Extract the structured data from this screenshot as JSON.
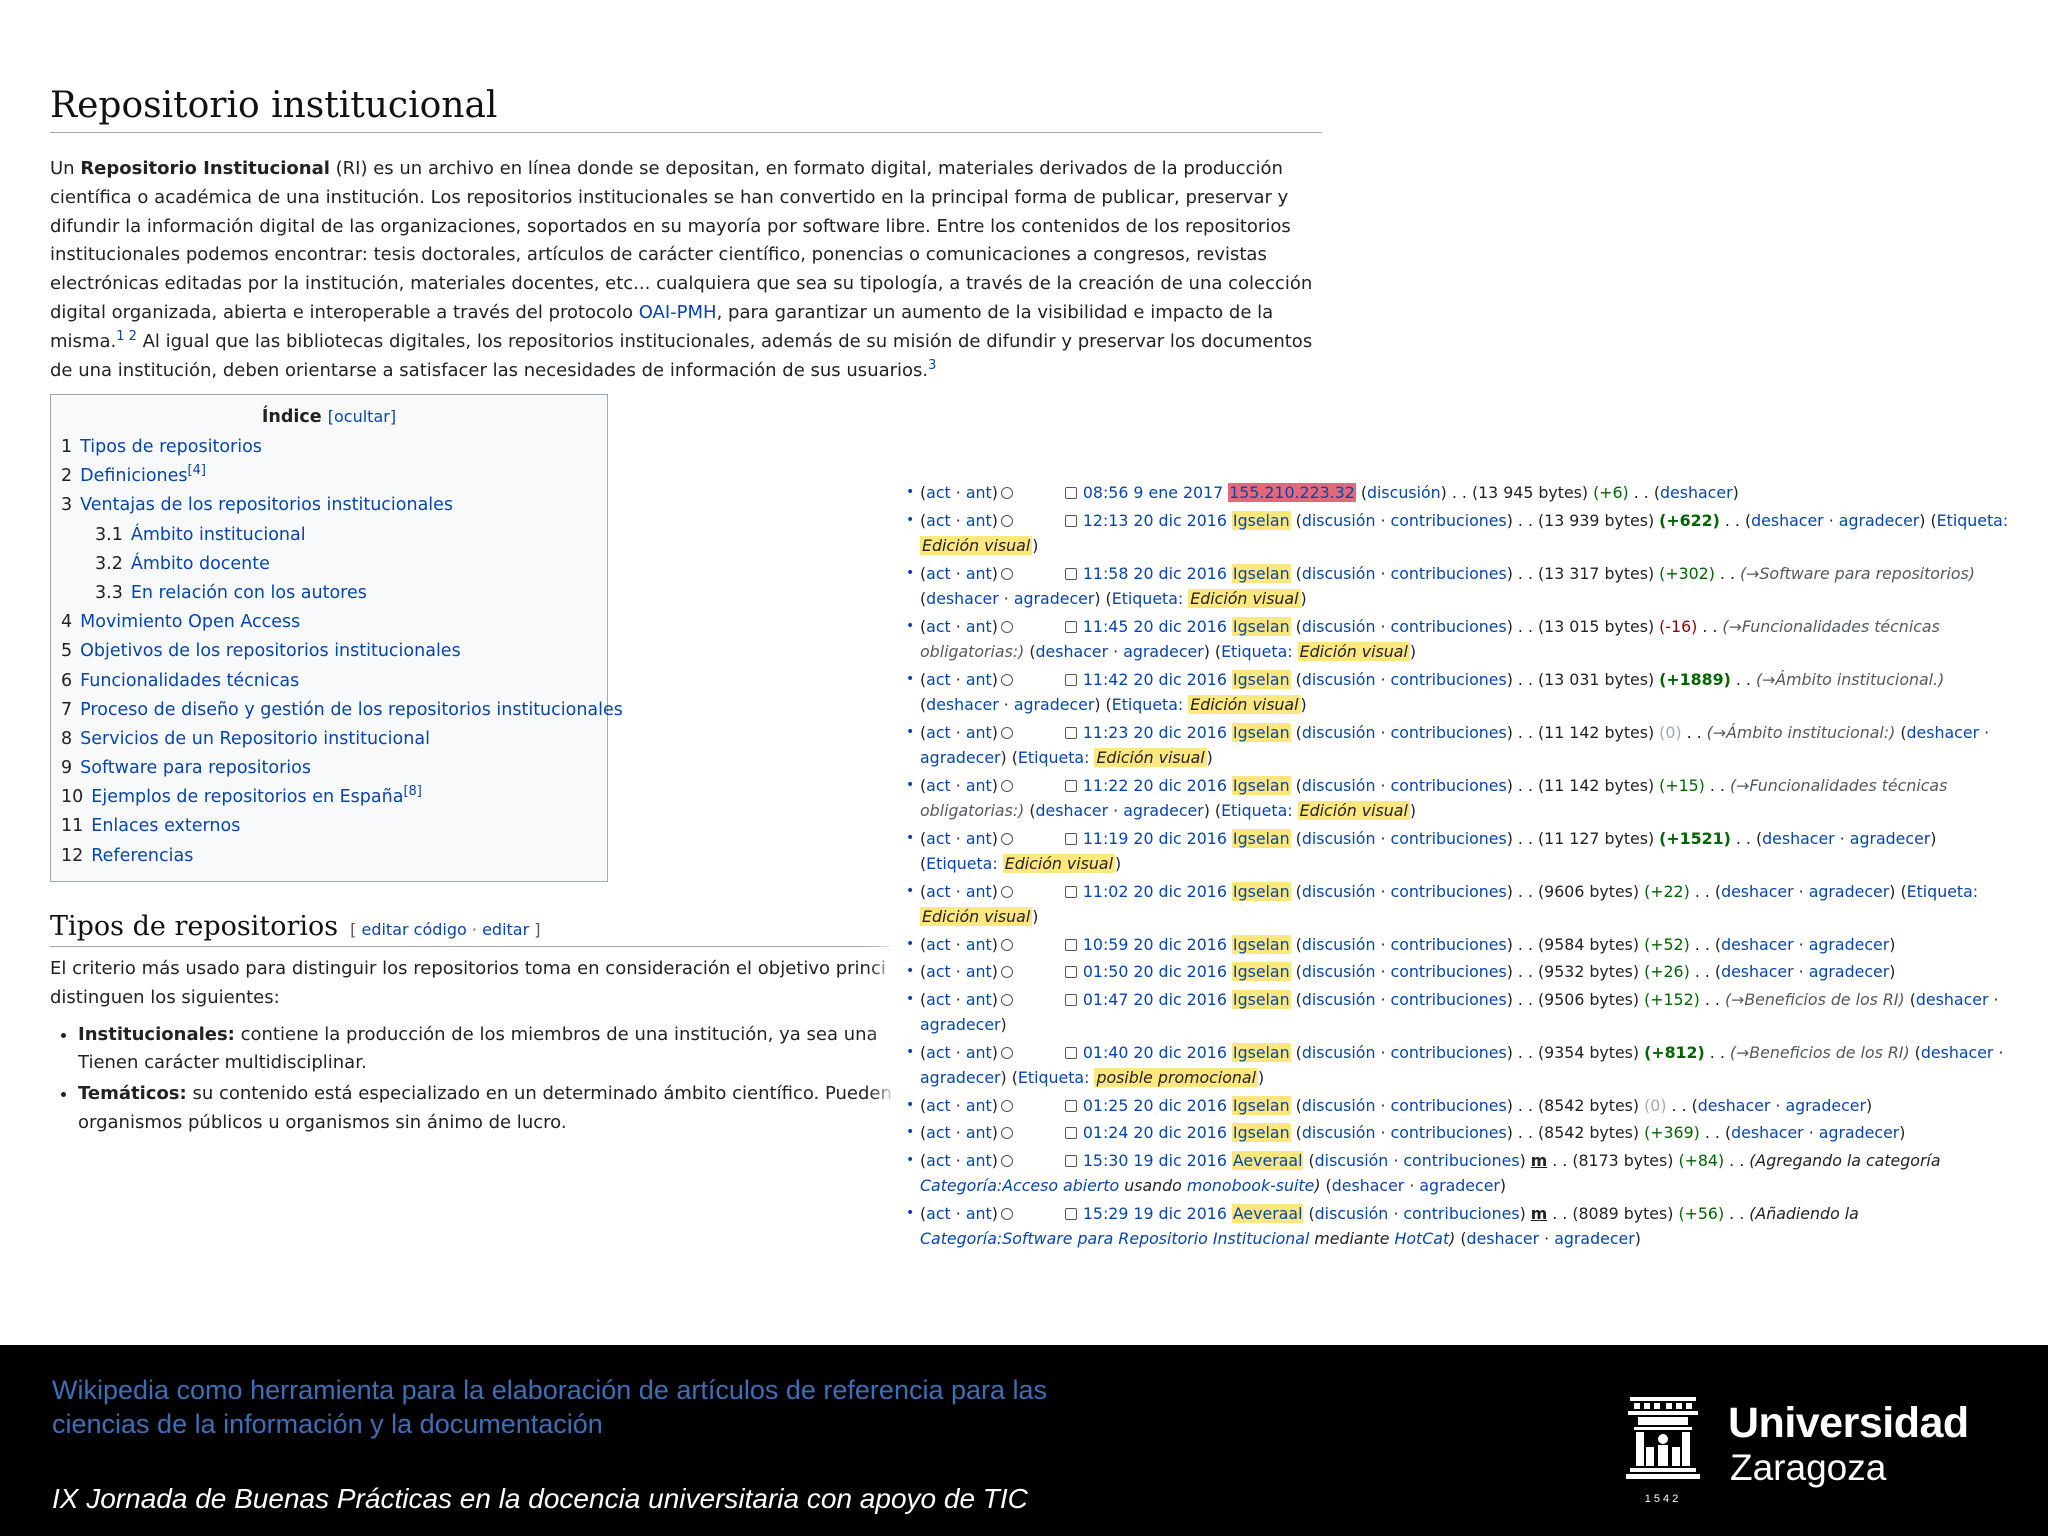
{
  "article": {
    "title": "Repositorio institucional",
    "intro_parts": {
      "p1": "Un ",
      "bold": "Repositorio Institucional",
      "p2": " (RI) es un archivo en línea donde se depositan, en formato digital, materiales derivados de la producción científica o académica de una institución. Los repositorios institucionales se han convertido en la principal forma de publicar, preservar y difundir la información digital de las organizaciones, soportados en su mayoría por software libre. Entre los contenidos de los repositorios institucionales podemos encontrar: tesis doctorales, artículos de carácter científico, ponencias o comunicaciones a congresos, revistas electrónicas editadas por la institución, materiales docentes, etc... cualquiera que sea su tipología, a través de la creación de una colección digital organizada, abierta e interoperable a través del protocolo ",
      "link": "OAI-PMH",
      "p3": ", para garantizar un aumento de la visibilidad e impacto de la misma.",
      "ref1": "1 2",
      "p4": " Al igual que las bibliotecas digitales, los repositorios institucionales, además de su misión de difundir y preservar los documentos de una institución, deben orientarse a satisfacer las necesidades de información de sus usuarios.",
      "ref2": "3"
    }
  },
  "toc": {
    "title": "Índice",
    "hide": "[ocultar]",
    "items": [
      {
        "num": "1",
        "label": "Tipos de repositorios",
        "sup": ""
      },
      {
        "num": "2",
        "label": "Definiciones",
        "sup": "[4]"
      },
      {
        "num": "3",
        "label": "Ventajas de los repositorios institucionales",
        "sup": ""
      },
      {
        "num": "3.1",
        "label": "Ámbito institucional",
        "sup": ""
      },
      {
        "num": "3.2",
        "label": "Ámbito docente",
        "sup": ""
      },
      {
        "num": "3.3",
        "label": "En relación con los autores",
        "sup": ""
      },
      {
        "num": "4",
        "label": "Movimiento Open Access",
        "sup": ""
      },
      {
        "num": "5",
        "label": "Objetivos de los repositorios institucionales",
        "sup": ""
      },
      {
        "num": "6",
        "label": "Funcionalidades técnicas",
        "sup": ""
      },
      {
        "num": "7",
        "label": "Proceso de diseño y gestión de los repositorios institucionales",
        "sup": ""
      },
      {
        "num": "8",
        "label": "Servicios de un Repositorio institucional",
        "sup": ""
      },
      {
        "num": "9",
        "label": "Software para repositorios",
        "sup": ""
      },
      {
        "num": "10",
        "label": "Ejemplos de repositorios en España",
        "sup": "[8]"
      },
      {
        "num": "11",
        "label": "Enlaces externos",
        "sup": ""
      },
      {
        "num": "12",
        "label": "Referencias",
        "sup": ""
      }
    ]
  },
  "section": {
    "heading": "Tipos de repositorios",
    "edit_open": "[ ",
    "edit_code": "editar código",
    "edit_sep": " · ",
    "edit": "editar",
    "edit_close": " ]",
    "text": "El criterio más usado para distinguir los repositorios toma en consideración el objetivo princi",
    "text2": "distinguen los siguientes:",
    "items": [
      {
        "bold": "Institucionales:",
        "text": " contiene la producción de los miembros de una institución, ya sea una ",
        "text2": "Tienen carácter multidisciplinar."
      },
      {
        "bold": "Temáticos:",
        "text": " su contenido está especializado en un determinado ámbito científico. Pueden",
        "text2": "organismos públicos u organismos sin ánimo de lucro."
      }
    ]
  },
  "history": {
    "act": "act",
    "ant": "ant",
    "discussion": "discusión",
    "contribs": "contribuciones",
    "undo": "deshacer",
    "thank": "agradecer",
    "tag_label": "Etiqueta:",
    "rows": [
      {
        "time": "08:56 9 ene 2017",
        "user": "155.210.223.32",
        "anon": true,
        "minor": "",
        "bytes": "(13 945 bytes)",
        "diff": "(+6)",
        "diff_class": "pos",
        "comment": "",
        "thank": false,
        "tag": ""
      },
      {
        "time": "12:13 20 dic 2016",
        "user": "Igselan",
        "anon": false,
        "minor": "",
        "bytes": "(13 939 bytes)",
        "diff": "(+622)",
        "diff_class": "posb",
        "comment": "",
        "thank": true,
        "tag": "Edición visual"
      },
      {
        "time": "11:58 20 dic 2016",
        "user": "Igselan",
        "anon": false,
        "minor": "",
        "bytes": "(13 317 bytes)",
        "diff": "(+302)",
        "diff_class": "pos",
        "comment": "(→Software para repositorios)",
        "thank": true,
        "tag": "Edición visual"
      },
      {
        "time": "11:45 20 dic 2016",
        "user": "Igselan",
        "anon": false,
        "minor": "",
        "bytes": "(13 015 bytes)",
        "diff": "(-16)",
        "diff_class": "neg",
        "comment": "(→Funcionalidades técnicas obligatorias:)",
        "thank": true,
        "tag": "Edición visual"
      },
      {
        "time": "11:42 20 dic 2016",
        "user": "Igselan",
        "anon": false,
        "minor": "",
        "bytes": "(13 031 bytes)",
        "diff": "(+1889)",
        "diff_class": "posb",
        "comment": "(→Ámbito institucional.)",
        "thank": true,
        "tag": "Edición visual"
      },
      {
        "time": "11:23 20 dic 2016",
        "user": "Igselan",
        "anon": false,
        "minor": "",
        "bytes": "(11 142 bytes)",
        "diff": "(0)",
        "diff_class": "zero",
        "comment": "(→Ámbito institucional:)",
        "thank": true,
        "tag": "Edición visual"
      },
      {
        "time": "11:22 20 dic 2016",
        "user": "Igselan",
        "anon": false,
        "minor": "",
        "bytes": "(11 142 bytes)",
        "diff": "(+15)",
        "diff_class": "pos",
        "comment": "(→Funcionalidades técnicas obligatorias:)",
        "thank": true,
        "tag": "Edición visual"
      },
      {
        "time": "11:19 20 dic 2016",
        "user": "Igselan",
        "anon": false,
        "minor": "",
        "bytes": "(11 127 bytes)",
        "diff": "(+1521)",
        "diff_class": "posb",
        "comment": "",
        "thank": true,
        "tag": "Edición visual"
      },
      {
        "time": "11:02 20 dic 2016",
        "user": "Igselan",
        "anon": false,
        "minor": "",
        "bytes": "(9606 bytes)",
        "diff": "(+22)",
        "diff_class": "pos",
        "comment": "",
        "thank": true,
        "tag": "Edición visual"
      },
      {
        "time": "10:59 20 dic 2016",
        "user": "Igselan",
        "anon": false,
        "minor": "",
        "bytes": "(9584 bytes)",
        "diff": "(+52)",
        "diff_class": "pos",
        "comment": "",
        "thank": true,
        "tag": ""
      },
      {
        "time": "01:50 20 dic 2016",
        "user": "Igselan",
        "anon": false,
        "minor": "",
        "bytes": "(9532 bytes)",
        "diff": "(+26)",
        "diff_class": "pos",
        "comment": "",
        "thank": true,
        "tag": ""
      },
      {
        "time": "01:47 20 dic 2016",
        "user": "Igselan",
        "anon": false,
        "minor": "",
        "bytes": "(9506 bytes)",
        "diff": "(+152)",
        "diff_class": "pos",
        "comment": "(→Beneficios de los RI)",
        "thank": true,
        "tag": ""
      },
      {
        "time": "01:40 20 dic 2016",
        "user": "Igselan",
        "anon": false,
        "minor": "",
        "bytes": "(9354 bytes)",
        "diff": "(+812)",
        "diff_class": "posb",
        "comment": "(→Beneficios de los RI)",
        "thank": true,
        "tag": "posible promocional"
      },
      {
        "time": "01:25 20 dic 2016",
        "user": "Igselan",
        "anon": false,
        "minor": "",
        "bytes": "(8542 bytes)",
        "diff": "(0)",
        "diff_class": "zero",
        "comment": "",
        "thank": true,
        "tag": ""
      },
      {
        "time": "01:24 20 dic 2016",
        "user": "Igselan",
        "anon": false,
        "minor": "",
        "bytes": "(8542 bytes)",
        "diff": "(+369)",
        "diff_class": "pos",
        "comment": "",
        "thank": true,
        "tag": ""
      },
      {
        "time": "15:30 19 dic 2016",
        "user": "Aeveraal",
        "anon": false,
        "minor": "m",
        "bytes": "(8173 bytes)",
        "diff": "(+84)",
        "diff_class": "pos",
        "comment": "",
        "comment_parts": [
          "(Agregando la categoría ",
          "Categoría:Acceso abierto",
          " usando ",
          "monobook-suite",
          ")"
        ],
        "thank": true,
        "tag": ""
      },
      {
        "time": "15:29 19 dic 2016",
        "user": "Aeveraal",
        "anon": false,
        "minor": "m",
        "bytes": "(8089 bytes)",
        "diff": "(+56)",
        "diff_class": "pos",
        "comment": "",
        "comment_parts": [
          "(Añadiendo la ",
          "Categoría:Software para Repositorio Institucional",
          " mediante ",
          "HotCat",
          ")"
        ],
        "thank": true,
        "tag": ""
      }
    ]
  },
  "footer": {
    "title": "Wikipedia como herramienta para la elaboración de artículos de referencia para las ciencias de la información y la documentación",
    "event": "IX Jornada de Buenas Prácticas en la docencia universitaria con apoyo de TIC",
    "logo_line1": "Universidad",
    "logo_line2": "Zaragoza",
    "logo_year": "1542",
    "colors": {
      "background": "#000000",
      "title": "#3d6fb6",
      "event": "#ffffff"
    }
  },
  "colors": {
    "link": "#0645ad",
    "user_highlight": "#ffe780",
    "ip_highlight": "#e3697a",
    "positive": "#006400",
    "negative": "#8b0000"
  }
}
